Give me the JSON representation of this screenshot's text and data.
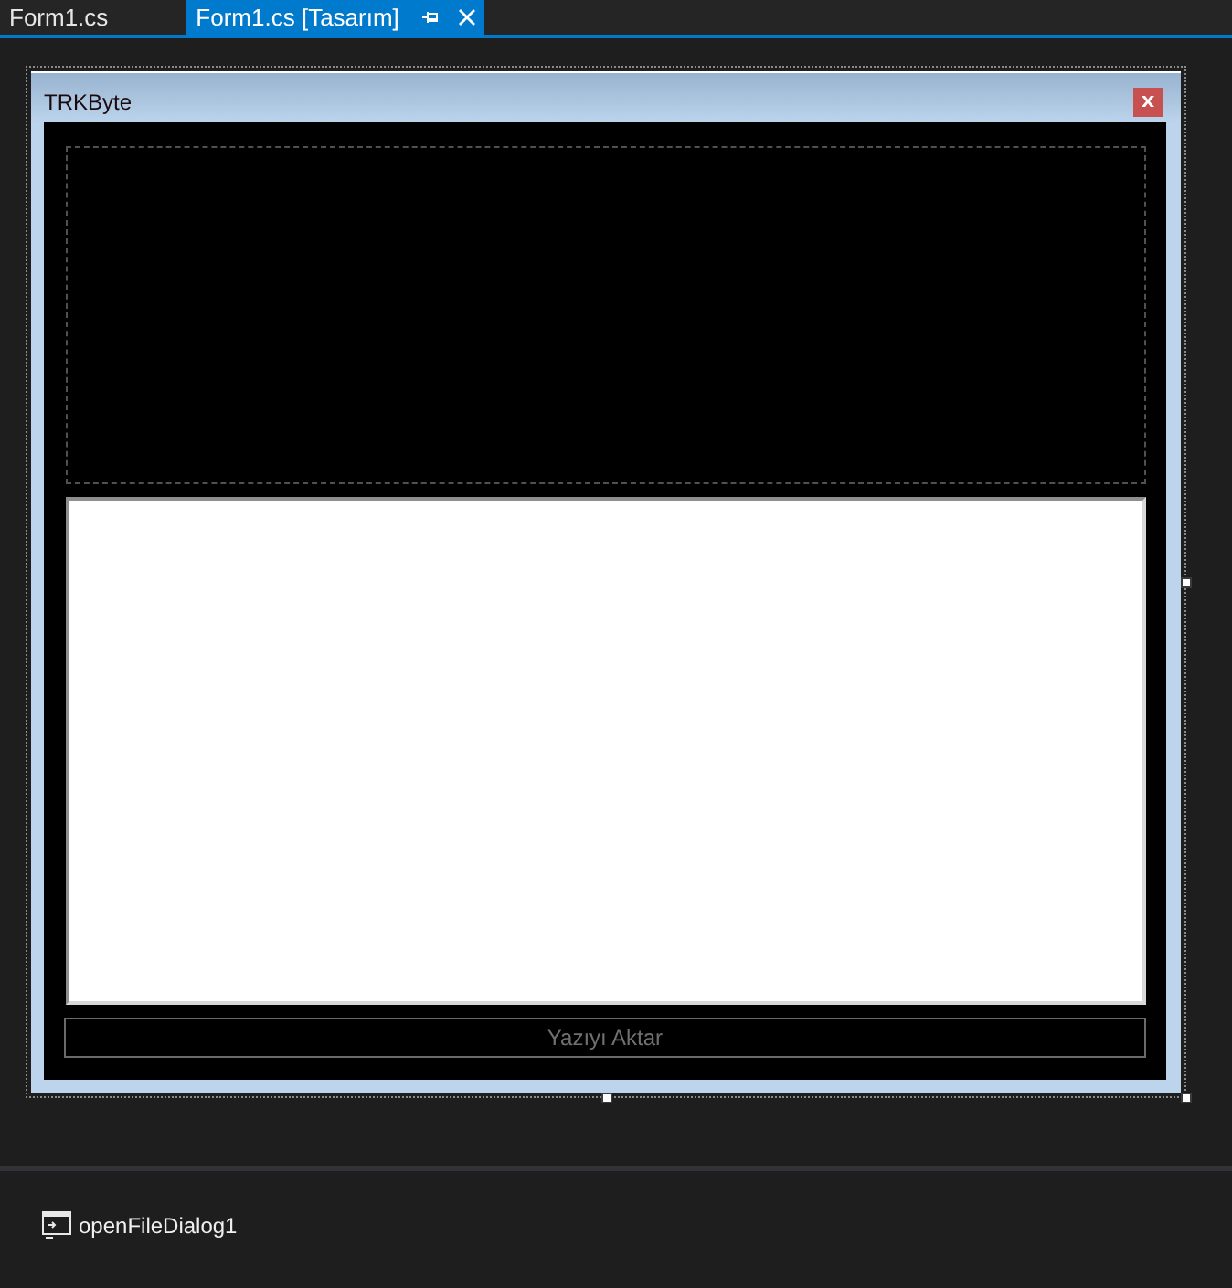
{
  "tabs": [
    {
      "label": "Form1.cs",
      "selected": false
    },
    {
      "label": "Form1.cs [Tasarım]",
      "selected": true
    }
  ],
  "form": {
    "title": "TRKByte",
    "button": "Yazıyı Aktar"
  },
  "component_tray": [
    {
      "label": "openFileDialog1"
    }
  ]
}
